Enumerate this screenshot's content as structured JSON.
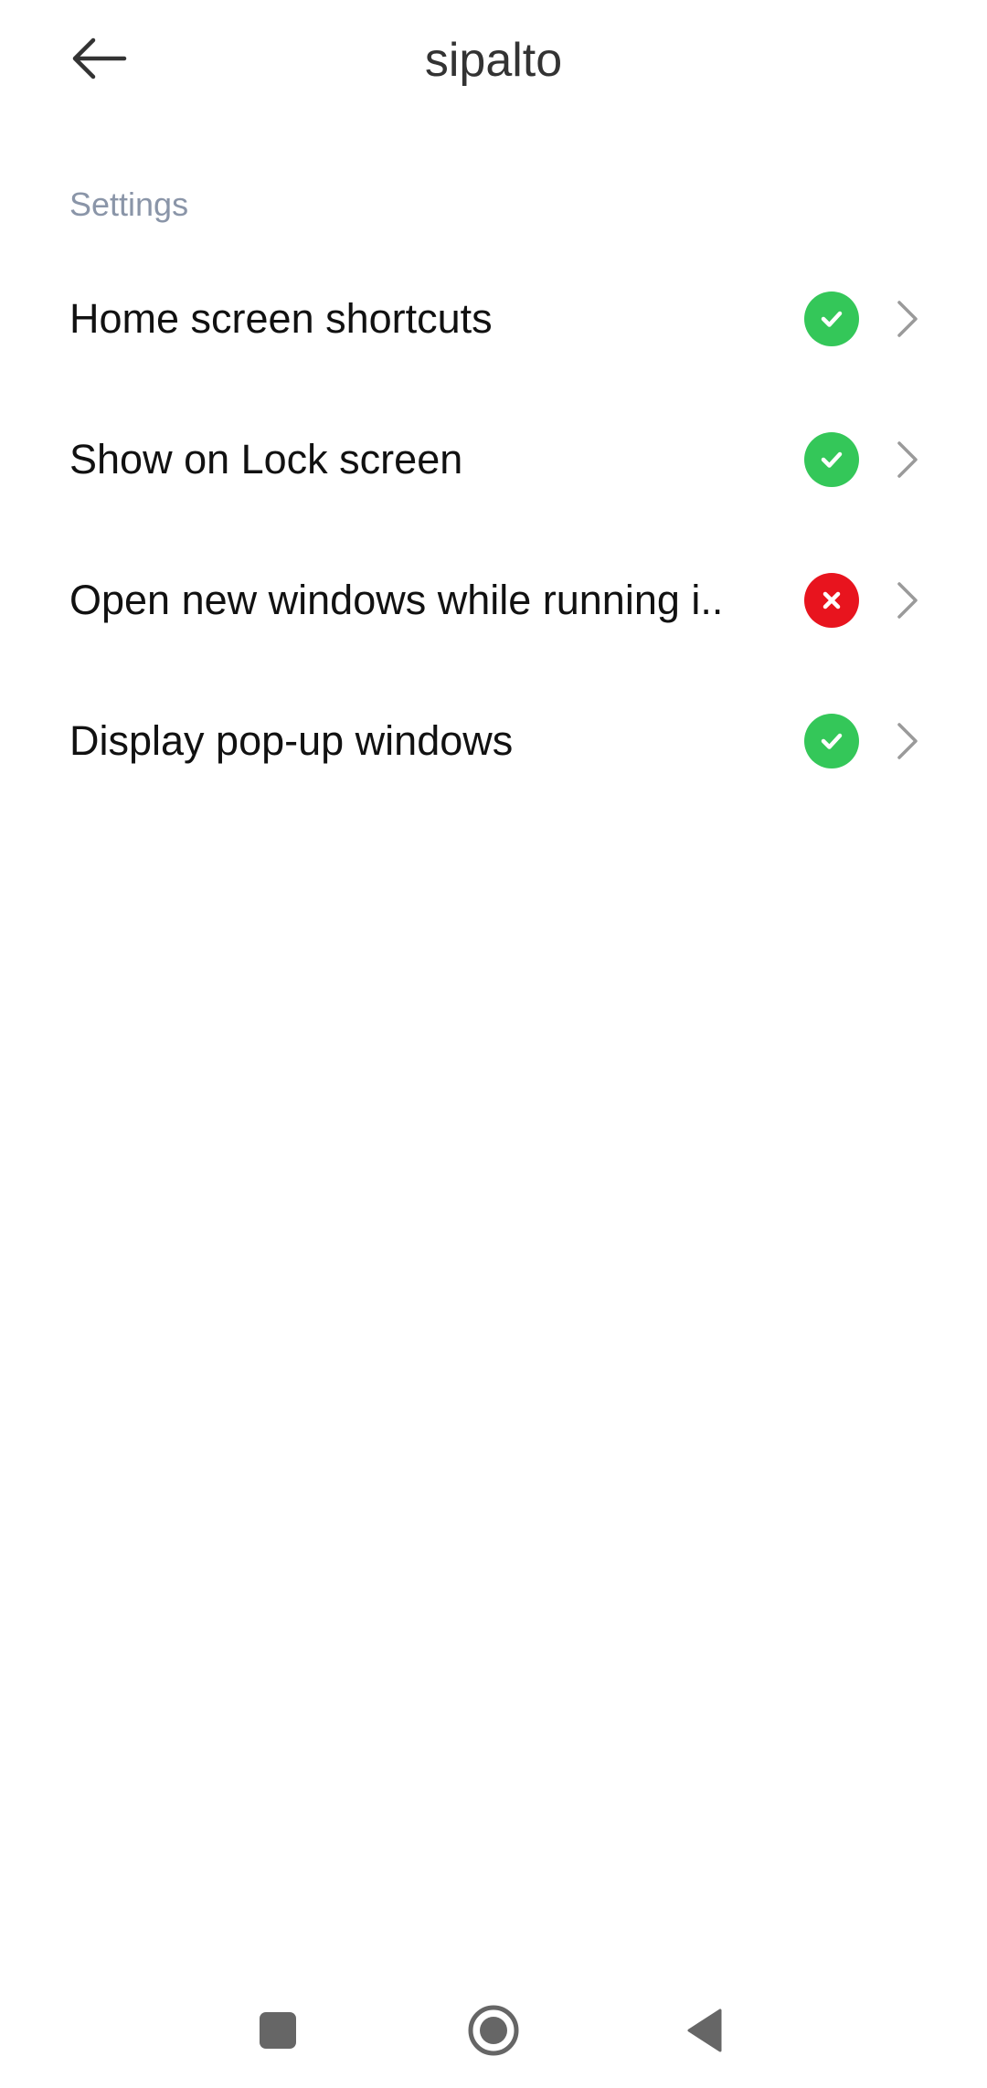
{
  "header": {
    "title": "sipalto",
    "back_icon": "arrow-left-icon"
  },
  "settings": {
    "section_title": "Settings",
    "items": [
      {
        "label": "Home screen shortcuts",
        "status": "allowed",
        "status_icon": "check-icon"
      },
      {
        "label": "Show on Lock screen",
        "status": "allowed",
        "status_icon": "check-icon"
      },
      {
        "label": "Open new windows while running i..",
        "status": "denied",
        "status_icon": "cross-icon"
      },
      {
        "label": "Display pop-up windows",
        "status": "allowed",
        "status_icon": "check-icon"
      }
    ]
  },
  "colors": {
    "allowed": "#34c759",
    "denied": "#e8141e",
    "section_header": "#8a95a8",
    "chevron": "#9a9a9a",
    "nav_icon": "#666666"
  },
  "nav": {
    "recents_icon": "square-icon",
    "home_icon": "circle-icon",
    "back_icon": "triangle-back-icon"
  }
}
